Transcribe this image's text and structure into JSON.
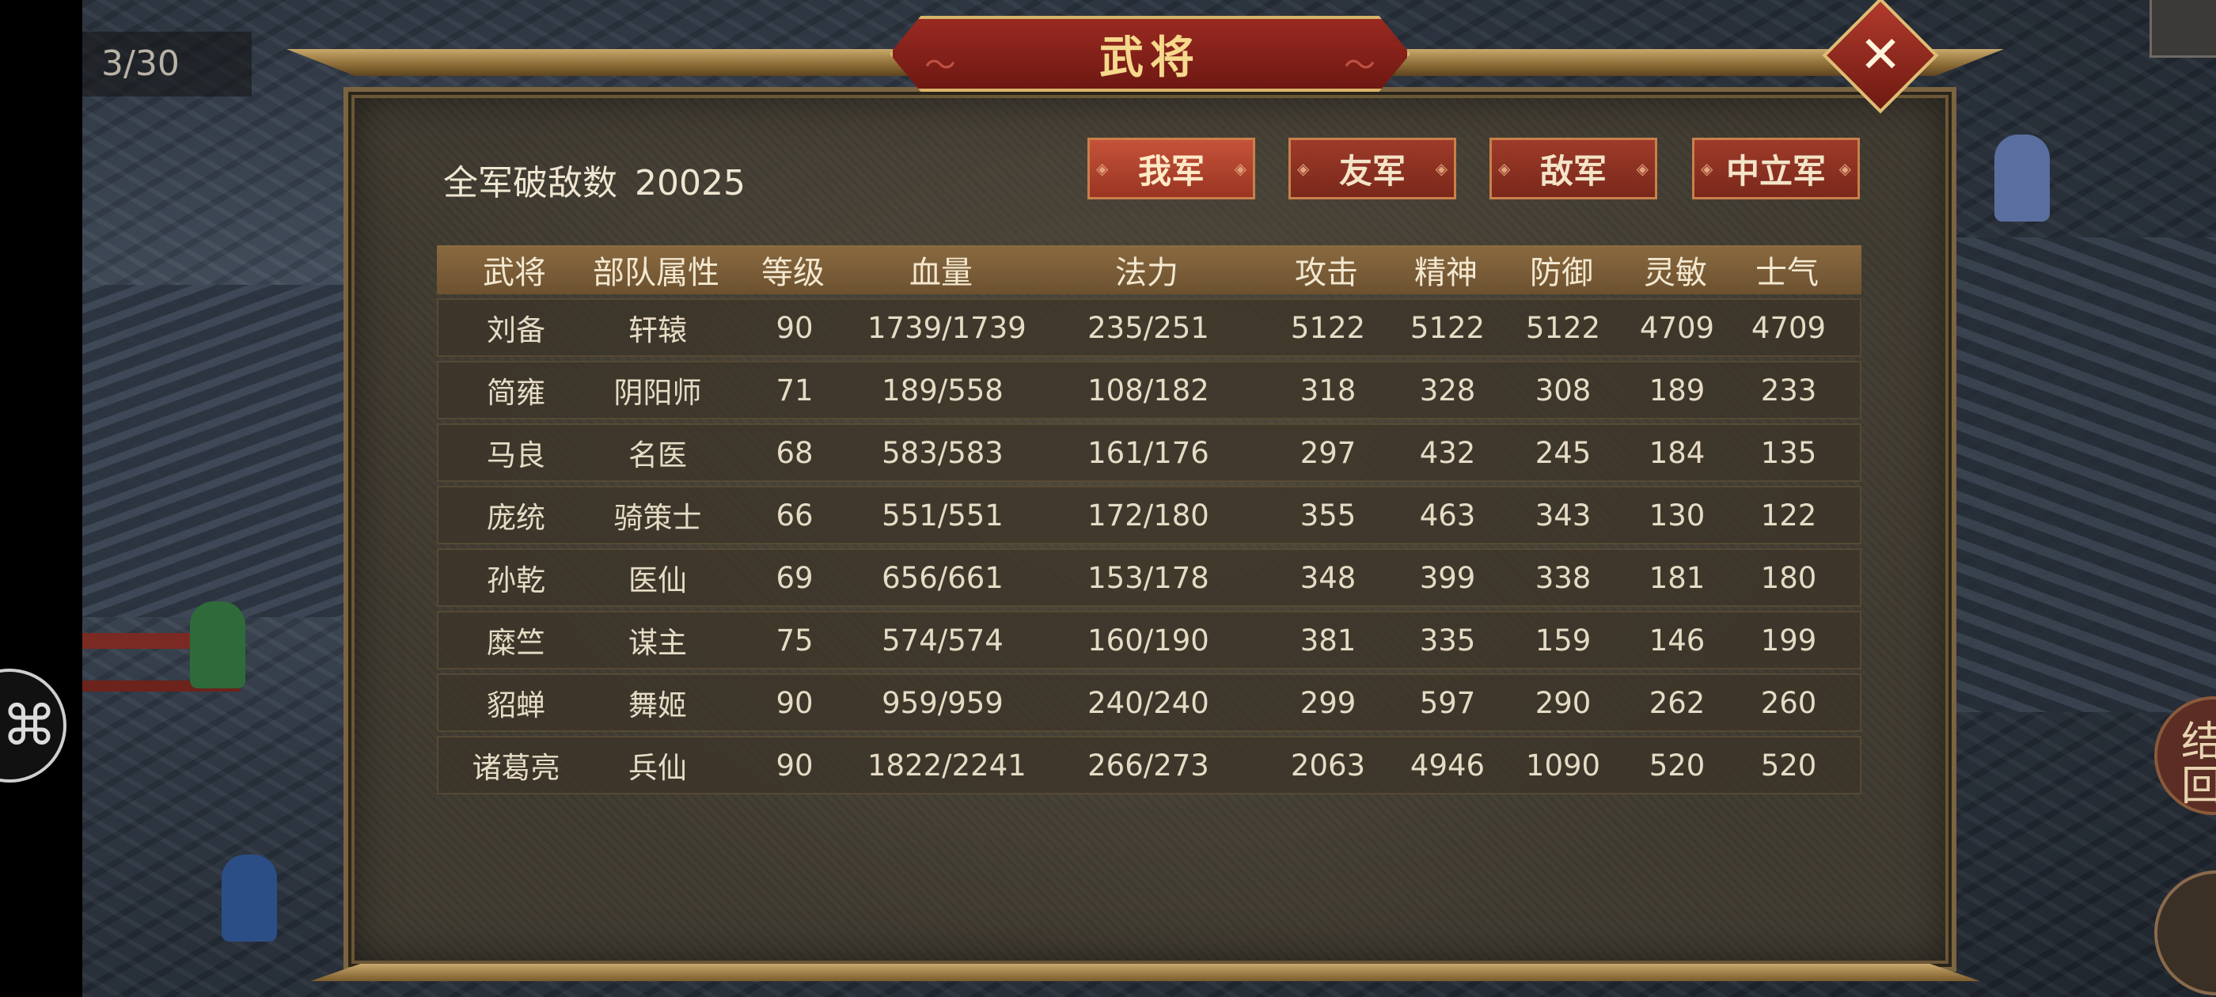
{
  "hud": {
    "page_counter": "3/30",
    "side_button_glyph": "⌘",
    "right_button_text": "结\n回"
  },
  "panel": {
    "title": "武将",
    "close_glyph": "✕",
    "kills_label": "全军破敌数",
    "kills_value": "20025"
  },
  "tabs": [
    {
      "label": "我军",
      "active": true
    },
    {
      "label": "友军",
      "active": false
    },
    {
      "label": "敌军",
      "active": false
    },
    {
      "label": "中立军",
      "active": false
    }
  ],
  "table": {
    "headers": [
      "武将",
      "部队属性",
      "等级",
      "血量",
      "法力",
      "攻击",
      "精神",
      "防御",
      "灵敏",
      "士气"
    ],
    "rows": [
      [
        "刘备",
        "轩辕",
        "90",
        "1739/1739",
        "235/251",
        "5122",
        "5122",
        "5122",
        "4709",
        "4709"
      ],
      [
        "简雍",
        "阴阳师",
        "71",
        "189/558",
        "108/182",
        "318",
        "328",
        "308",
        "189",
        "233"
      ],
      [
        "马良",
        "名医",
        "68",
        "583/583",
        "161/176",
        "297",
        "432",
        "245",
        "184",
        "135"
      ],
      [
        "庞统",
        "骑策士",
        "66",
        "551/551",
        "172/180",
        "355",
        "463",
        "343",
        "130",
        "122"
      ],
      [
        "孙乾",
        "医仙",
        "69",
        "656/661",
        "153/178",
        "348",
        "399",
        "338",
        "181",
        "180"
      ],
      [
        "糜竺",
        "谋主",
        "75",
        "574/574",
        "160/190",
        "381",
        "335",
        "159",
        "146",
        "199"
      ],
      [
        "貂蝉",
        "舞姬",
        "90",
        "959/959",
        "240/240",
        "299",
        "597",
        "290",
        "262",
        "260"
      ],
      [
        "诸葛亮",
        "兵仙",
        "90",
        "1822/2241",
        "266/273",
        "2063",
        "4946",
        "1090",
        "520",
        "520"
      ]
    ]
  },
  "colors": {
    "title_plate": "#8a2218",
    "tab_button": "#9e3b2a",
    "panel_bg": "#3f3a30",
    "header_bar": "#7a5c38",
    "text": "#e6dcc6"
  }
}
